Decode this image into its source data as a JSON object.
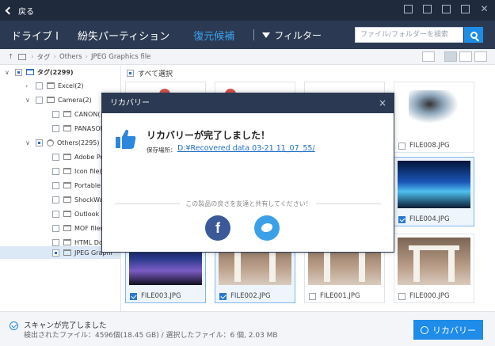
{
  "topbar": {
    "back_label": "戻る"
  },
  "nav": {
    "tabs": [
      "ドライブ I",
      "紛失パーティション",
      "復元候補"
    ],
    "active_tab": 2,
    "filter_label": "フィルター",
    "search_placeholder": "ファイル/フォルダーを検索"
  },
  "path": {
    "crumbs": [
      "タグ",
      "Others",
      "JPEG Graphics file"
    ]
  },
  "tree": {
    "root": "タグ(2299)",
    "excel": "Excel(2)",
    "camera": "Camera(2)",
    "canon": "CANON(1",
    "panasonic": "PANASON",
    "others": "Others(2295)",
    "adobe": "Adobe Po",
    "icon": "Icon file(1",
    "portable": "Portable N",
    "shockwave": "ShockWav",
    "outlook": "Outlook E",
    "mof": "MOF file(1",
    "html": "HTML Doc",
    "jpeg": "JPEG Graphi"
  },
  "grid": {
    "select_all": "すべて選択",
    "files": {
      "file008": "FILE008.JPG",
      "file004": "FILE004.JPG",
      "file003": "FILE003.JPG",
      "file002": "FILE002.JPG",
      "file001": "FILE001.JPG",
      "file000": "FILE000.JPG"
    }
  },
  "status": {
    "done": "スキャンが完了しました",
    "detail": "検出されたファイル：4596個(18.45 GB) / 選択したファイル：6  個, 2.03 MB",
    "recover_button": "リカバリー"
  },
  "modal": {
    "header": "リカバリー",
    "close": "×",
    "title": "リカバリーが完了しました！",
    "location_label": "保存場所：",
    "location_path": "D:¥Recovered data 03-21 11_07_55/",
    "share_text": "この製品の良さを友達と共有してください！",
    "facebook": "f"
  },
  "colors": {
    "accent": "#1e8ce8",
    "header_dark": "#1f2a3c",
    "nav": "#2b3a52"
  }
}
